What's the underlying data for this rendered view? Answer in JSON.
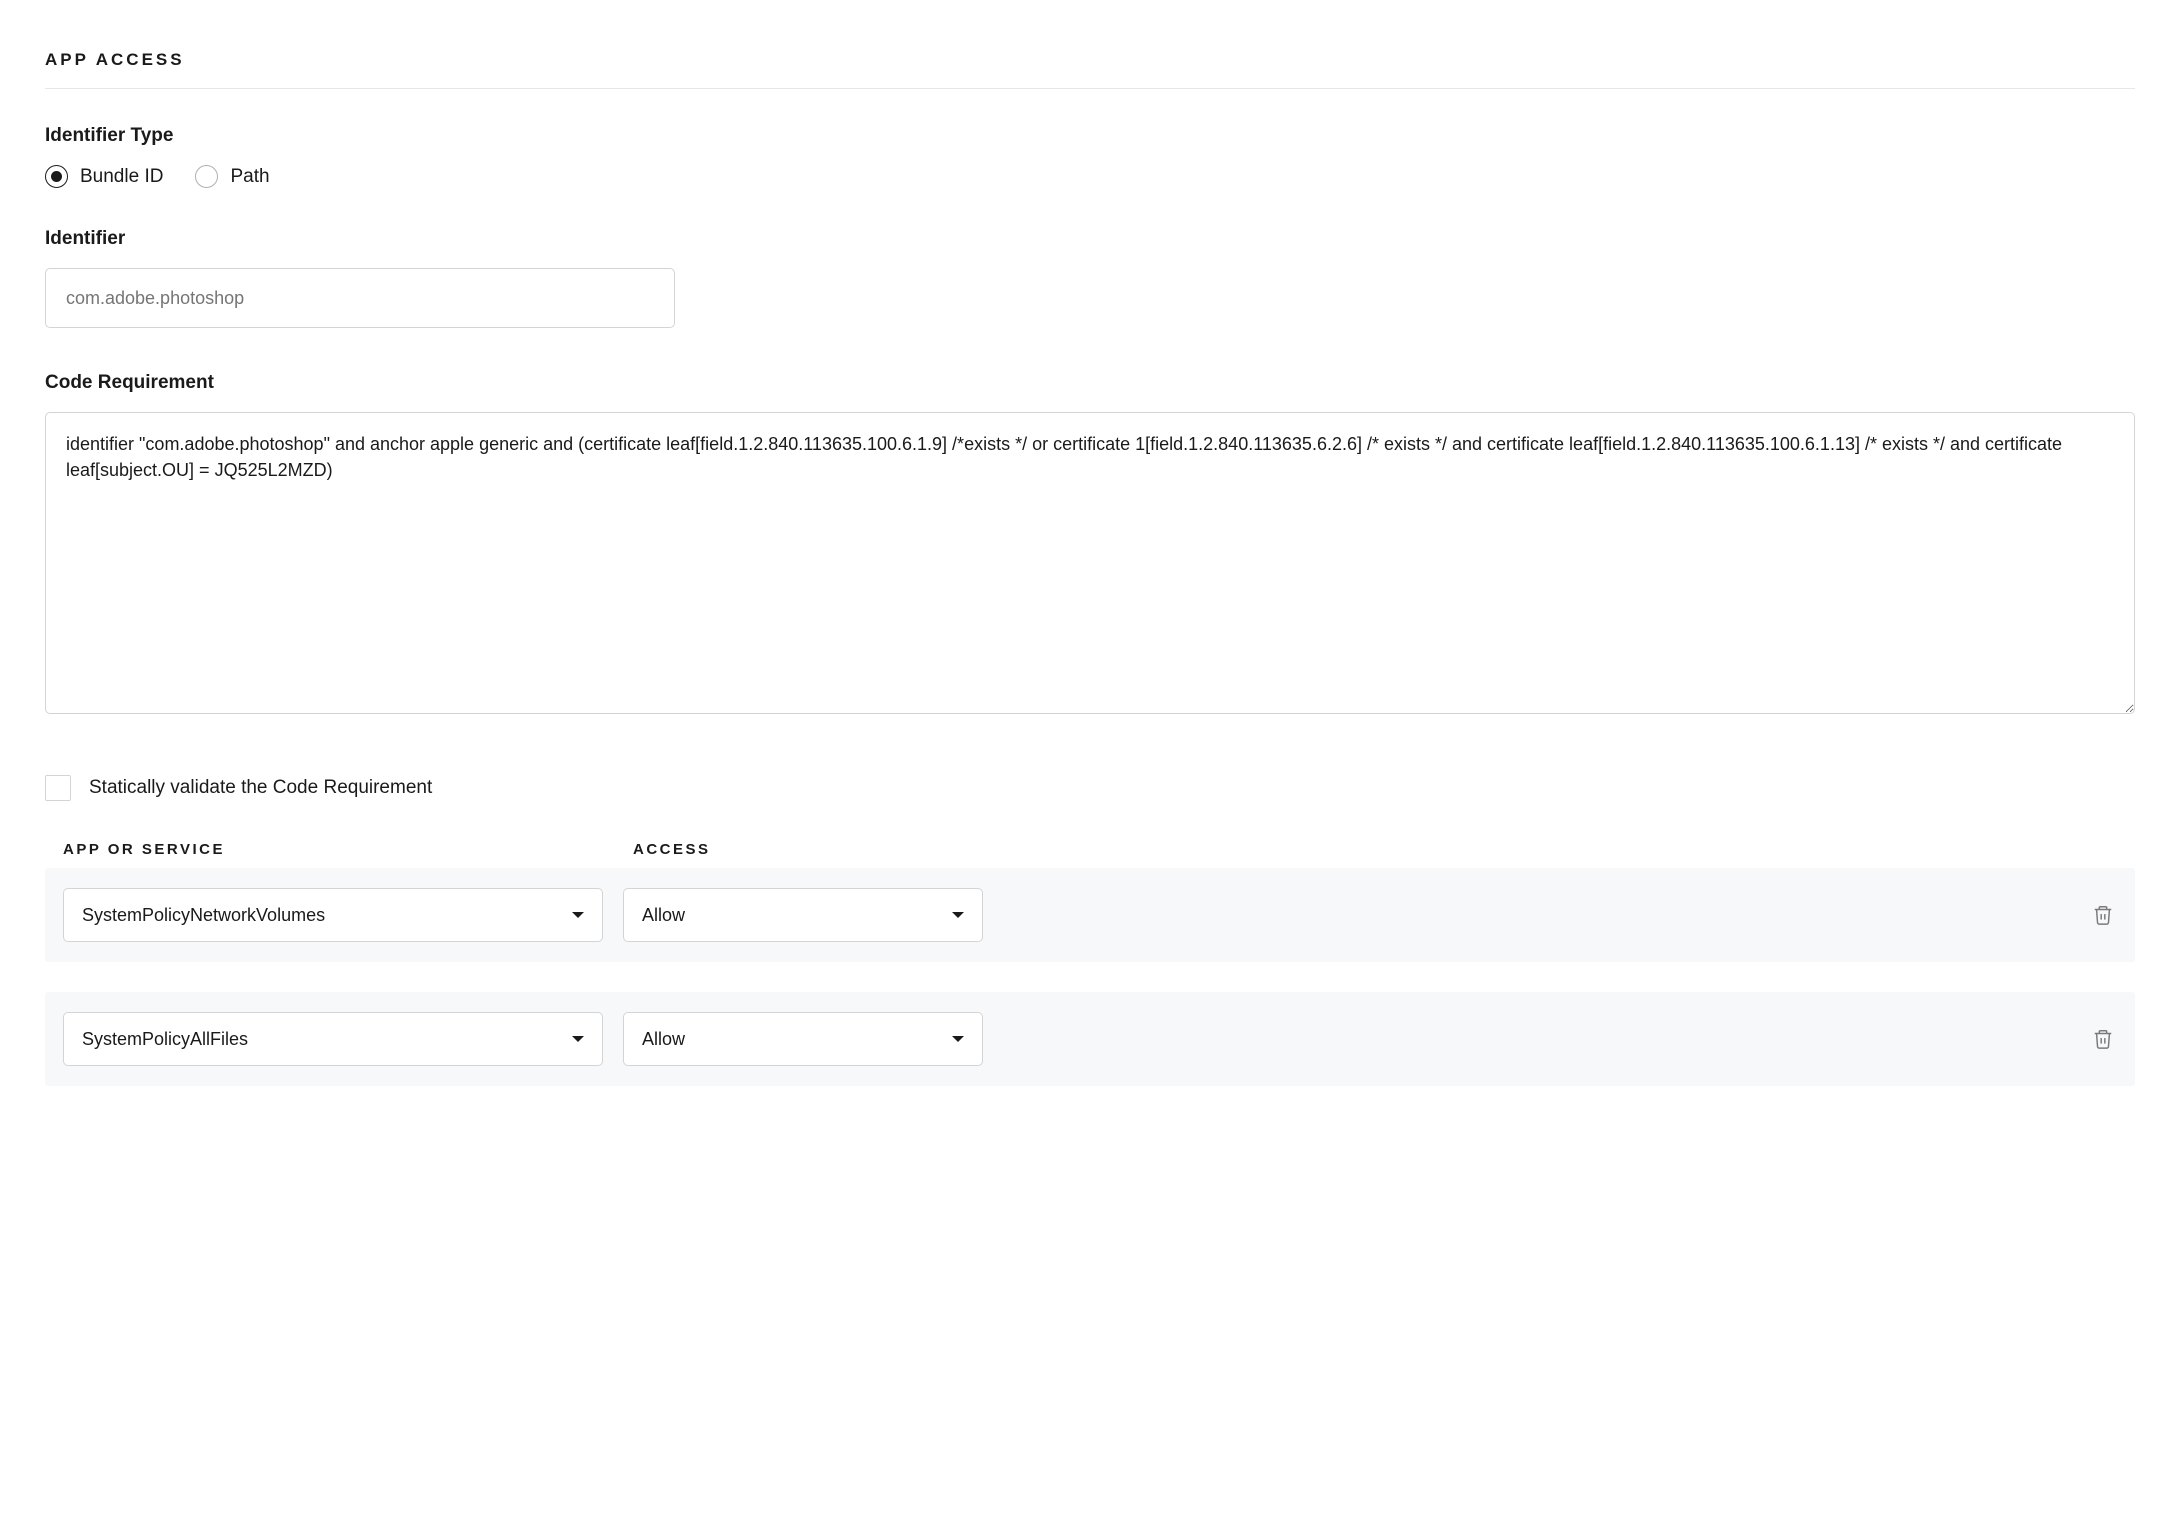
{
  "section_title": "APP ACCESS",
  "identifier_type": {
    "label": "Identifier Type",
    "options": {
      "bundle": "Bundle ID",
      "path": "Path"
    },
    "selected": "bundle"
  },
  "identifier": {
    "label": "Identifier",
    "placeholder": "com.adobe.photoshop"
  },
  "code_requirement": {
    "label": "Code Requirement",
    "value": "identifier \"com.adobe.photoshop\" and anchor apple generic and (certificate leaf[field.1.2.840.113635.100.6.1.9] /*exists */ or certificate 1[field.1.2.840.113635.6.2.6] /* exists */ and certificate leaf[field.1.2.840.113635.100.6.1.13] /* exists */ and certificate leaf[subject.OU] = JQ525L2MZD)"
  },
  "static_validate": {
    "label": "Statically validate the Code Requirement",
    "checked": false
  },
  "table": {
    "headers": {
      "service": "APP OR SERVICE",
      "access": "ACCESS"
    },
    "rows": [
      {
        "service": "SystemPolicyNetworkVolumes",
        "access": "Allow"
      },
      {
        "service": "SystemPolicyAllFiles",
        "access": "Allow"
      }
    ]
  }
}
